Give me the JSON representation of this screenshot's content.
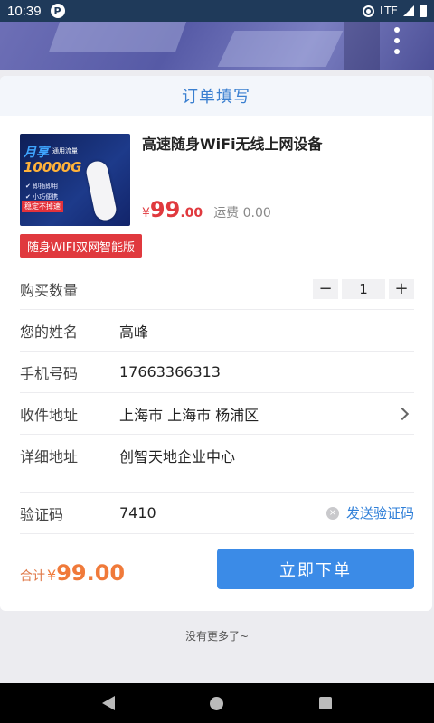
{
  "status_bar": {
    "time": "10:39",
    "network": "LTE"
  },
  "header": {
    "title": "订单填写"
  },
  "product": {
    "title": "高速随身WiFi无线上网设备",
    "price_symbol": "¥",
    "price_int": "99",
    "price_dec": ".00",
    "shipping": "运费 0.00",
    "tag": "随身WIFI双网智能版",
    "image_text": {
      "line1": "月享",
      "line1b": "通用流量",
      "line2": "10000G",
      "feature1": "✔ 即插即用",
      "feature2": "✔ 小巧便携",
      "badge": "稳定不掉速"
    }
  },
  "form": {
    "quantity": {
      "label": "购买数量",
      "value": "1",
      "minus": "−",
      "plus": "+"
    },
    "name": {
      "label": "您的姓名",
      "value": "高峰"
    },
    "phone": {
      "label": "手机号码",
      "value": "17663366313"
    },
    "region": {
      "label": "收件地址",
      "value": "上海市 上海市 杨浦区"
    },
    "address": {
      "label": "详细地址",
      "value": "创智天地企业中心"
    },
    "code": {
      "label": "验证码",
      "value": "7410",
      "send_label": "发送验证码",
      "clear": "×"
    }
  },
  "footer": {
    "total_label": "合计",
    "total_symbol": "¥",
    "total_value": "99.00",
    "submit_label": "立即下单"
  },
  "no_more": "没有更多了~",
  "colors": {
    "accent": "#3b8be7",
    "price": "#e0393e",
    "total": "#f07a3a"
  }
}
